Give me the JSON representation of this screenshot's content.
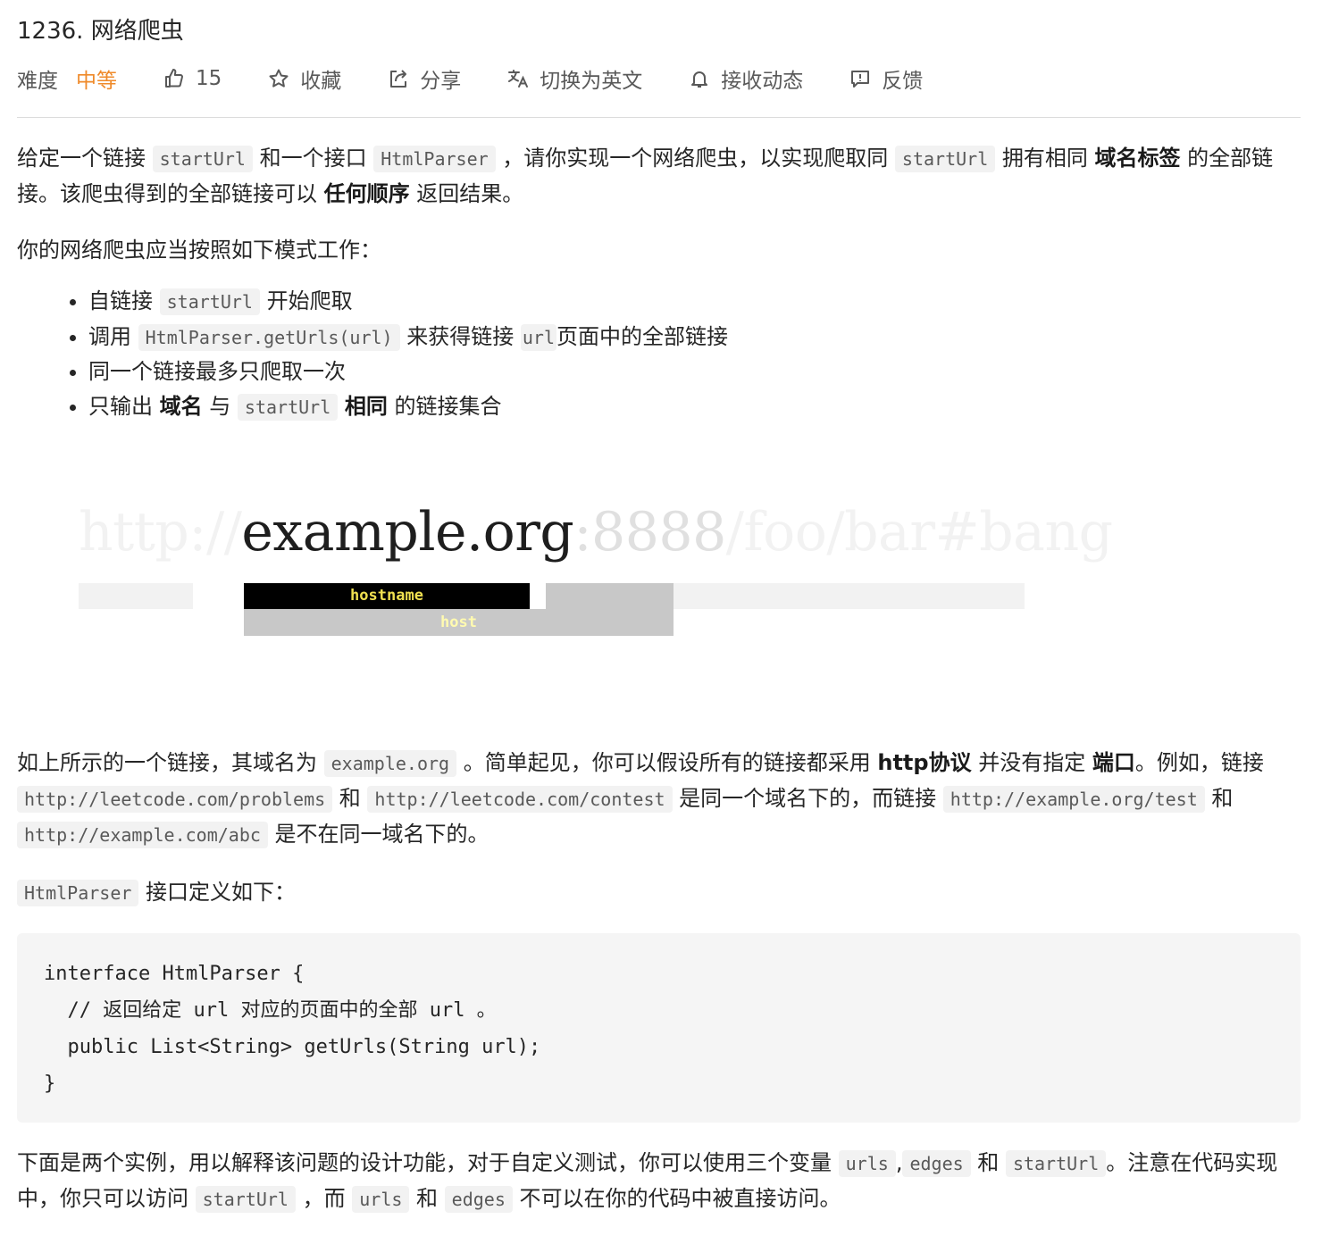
{
  "title": "1236. 网络爬虫",
  "toolbar": {
    "difficulty_label": "难度",
    "difficulty_value": "中等",
    "likes": "15",
    "favorite": "收藏",
    "share": "分享",
    "translate": "切换为英文",
    "subscribe": "接收动态",
    "feedback": "反馈"
  },
  "colors": {
    "difficulty": "#ef8a2a",
    "code_bg": "#f2f2f2",
    "hostname_bar": "#000000",
    "host_bar": "#c8c8c8"
  },
  "intro": {
    "t1": "给定一个链接 ",
    "c1": "startUrl",
    "t2": " 和一个接口 ",
    "c2": "HtmlParser",
    "t3": " ，请你实现一个网络爬虫，以实现爬取同 ",
    "c3": "startUrl",
    "t4": " 拥有相同 ",
    "b1": "域名标签",
    "t5": " 的全部链接。该爬虫得到的全部链接可以 ",
    "b2": "任何顺序",
    "t6": " 返回结果。"
  },
  "mode_intro": "你的网络爬虫应当按照如下模式工作：",
  "bullets": {
    "b1_t1": "自链接 ",
    "b1_c1": "startUrl",
    "b1_t2": " 开始爬取",
    "b2_t1": "调用 ",
    "b2_c1": "HtmlParser.getUrls(url)",
    "b2_t2": " 来获得链接",
    "b2_c2": "url",
    "b2_t3": "页面中的全部链接",
    "b3": "同一个链接最多只爬取一次",
    "b4_t1": "只输出 ",
    "b4_b1": "域名",
    "b4_t2": " 与 ",
    "b4_c1": "startUrl",
    "b4_t3": " ",
    "b4_b2": "相同",
    "b4_t4": " 的链接集合"
  },
  "figure": {
    "scheme": "http://",
    "hostname": "example.org",
    "port": ":8888",
    "path": "/foo/bar#bang",
    "hostname_label": "hostname",
    "host_label": "host"
  },
  "explain": {
    "t1": "如上所示的一个链接，其域名为 ",
    "c1": "example.org",
    "t2": " 。简单起见，你可以假设所有的链接都采用 ",
    "b1": "http协议",
    "t3": " 并没有指定 ",
    "b2": "端口",
    "t4": "。例如，链接 ",
    "c2": "http://leetcode.com/problems",
    "t5": " 和 ",
    "c3": "http://leetcode.com/contest",
    "t6": " 是同一个域名下的，而链接 ",
    "c4": "http://example.org/test",
    "t7": " 和 ",
    "c5": "http://example.com/abc",
    "t8": " 是不在同一域名下的。"
  },
  "iface": {
    "c1": "HtmlParser",
    "t1": " 接口定义如下："
  },
  "code": "interface HtmlParser {\n  // 返回给定 url 对应的页面中的全部 url 。\n  public List<String> getUrls(String url);\n}",
  "examples": {
    "t1": "下面是两个实例，用以解释该问题的设计功能，对于自定义测试，你可以使用三个变量 ",
    "c1": "urls",
    "t2": ",",
    "c2": "edges",
    "t3": " 和 ",
    "c3": "startUrl",
    "t4": "。注意在代码实现中，你只可以访问 ",
    "c4": "startUrl",
    "t5": " ，而 ",
    "c5": "urls",
    "t6": " 和 ",
    "c6": "edges",
    "t7": " 不可以在你的代码中被直接访问。"
  }
}
